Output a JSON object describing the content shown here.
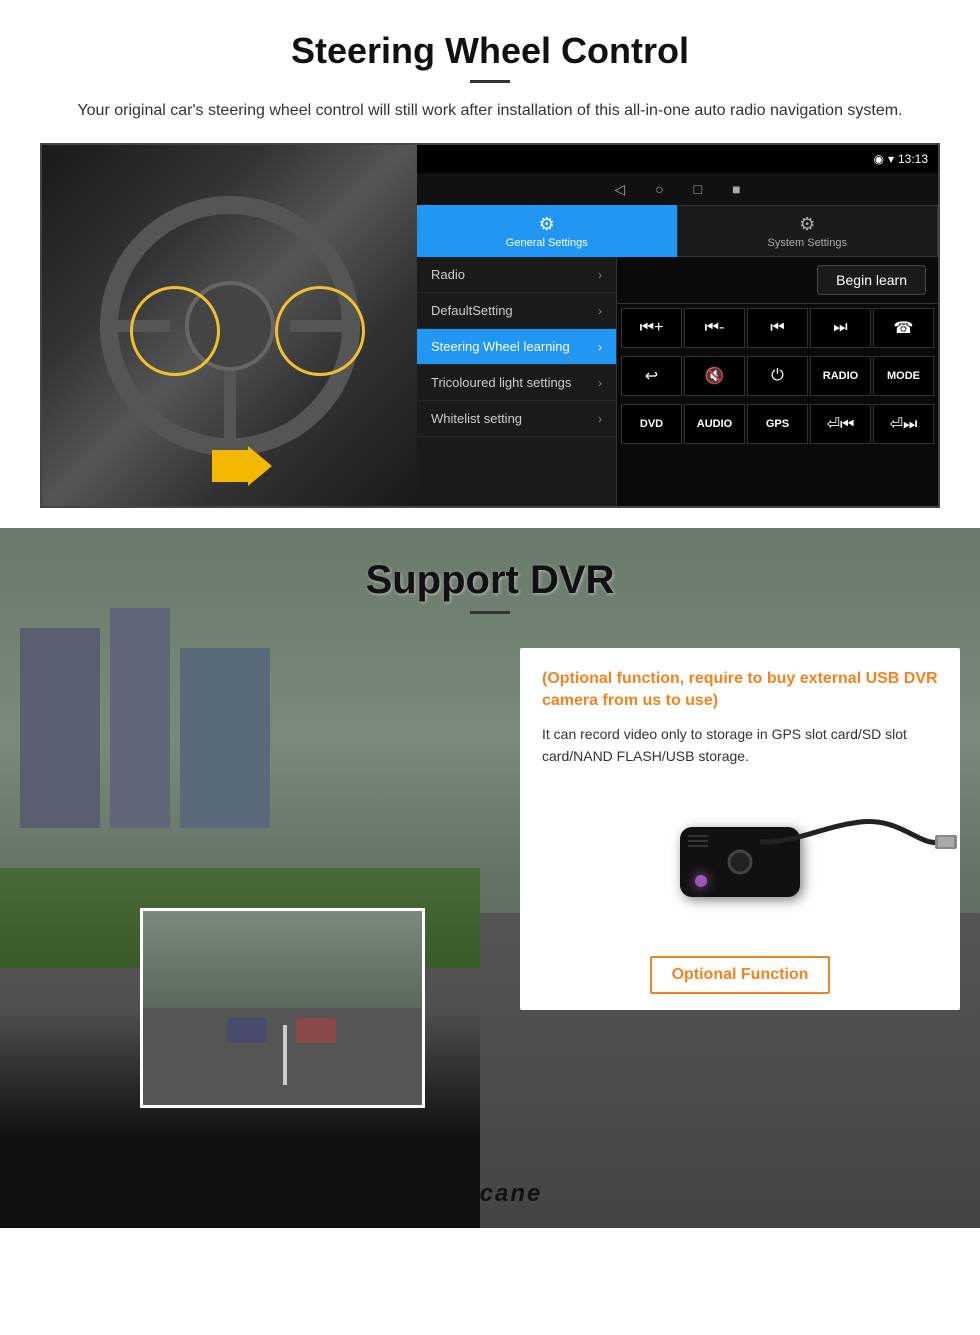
{
  "section1": {
    "title": "Steering Wheel Control",
    "subtitle": "Your original car's steering wheel control will still work after installation of this all-in-one auto radio navigation system.",
    "android": {
      "status_bar": {
        "time": "13:13",
        "signal_icon": "▼",
        "wifi_icon": "▾",
        "battery_icon": "▮"
      },
      "nav_icons": [
        "◁",
        "○",
        "□",
        "■"
      ],
      "tabs": [
        {
          "label": "General Settings",
          "icon": "⚙",
          "active": true
        },
        {
          "label": "System Settings",
          "icon": "⚙",
          "active": false
        }
      ],
      "menu_items": [
        {
          "label": "Radio",
          "active": false
        },
        {
          "label": "DefaultSetting",
          "active": false
        },
        {
          "label": "Steering Wheel learning",
          "active": true
        },
        {
          "label": "Tricoloured light settings",
          "active": false
        },
        {
          "label": "Whitelist setting",
          "active": false
        }
      ],
      "begin_learn_button": "Begin learn",
      "control_buttons_row1": [
        "⏮+",
        "⏮-",
        "⏮",
        "⏭",
        "☎"
      ],
      "control_buttons_row2": [
        "↩",
        "🔇",
        "⏻",
        "RADIO",
        "MODE"
      ],
      "control_buttons_row3": [
        "DVD",
        "AUDIO",
        "GPS",
        "⏎⏮",
        "⏎⏭"
      ]
    }
  },
  "section2": {
    "title": "Support DVR",
    "optional_text": "(Optional function, require to buy external USB DVR camera from us to use)",
    "description": "It can record video only to storage in GPS slot card/SD slot card/NAND FLASH/USB storage.",
    "optional_badge": "Optional Function",
    "brand": "Seicane"
  }
}
